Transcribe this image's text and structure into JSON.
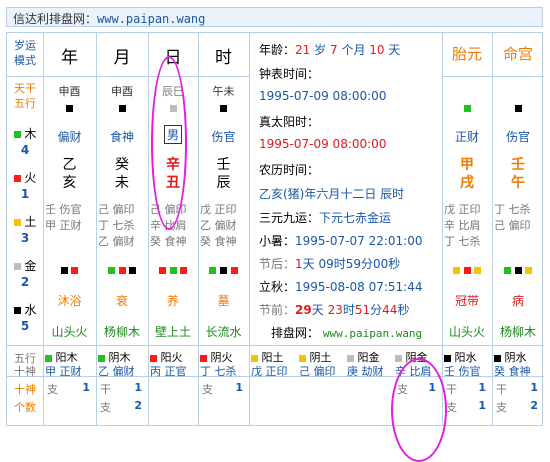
{
  "topbar": {
    "site": "信达利排盘网：",
    "url": "www.paipan.wang"
  },
  "left": {
    "row1": [
      "岁运",
      "模式"
    ],
    "row2": [
      "天干",
      "五行"
    ],
    "elements": [
      {
        "name": "木",
        "count": "4"
      },
      {
        "name": "火",
        "count": "1"
      },
      {
        "name": "土",
        "count": "3"
      },
      {
        "name": "金",
        "count": "2"
      },
      {
        "name": "水",
        "count": "5"
      }
    ],
    "bottom1": [
      "五行",
      "十神"
    ],
    "bottom2": [
      "十神",
      "个数"
    ]
  },
  "pillars": {
    "headers": [
      "年",
      "月",
      "日",
      "时"
    ],
    "hidden": [
      "申酉",
      "申酉",
      "辰巳",
      "午未"
    ],
    "shishen_top": [
      "偏财",
      "食神",
      "男",
      "伤官"
    ],
    "gan": [
      "乙",
      "癸",
      "辛",
      "壬"
    ],
    "zhi": [
      "亥",
      "未",
      "丑",
      "辰"
    ],
    "canggan": [
      [
        "壬 伤官",
        "甲 正财"
      ],
      [
        "己 偏印",
        "丁 七杀",
        "乙 偏财"
      ],
      [
        "己 偏印",
        "辛 比肩",
        "癸 食神"
      ],
      [
        "戊 正印",
        "乙 偏财",
        "癸 食神"
      ]
    ],
    "state": [
      "沐浴",
      "衰",
      "养",
      "墓"
    ],
    "nayin": [
      "山头火",
      "杨柳木",
      "壁上土",
      "长流水"
    ]
  },
  "info": {
    "age": {
      "label": "年龄：",
      "y": "21",
      "yl": "岁",
      "m": "7",
      "ml": "个月",
      "d": "10",
      "dl": "天"
    },
    "clock_label": "钟表时间：",
    "clock_value": "1995-07-09 08:00:00",
    "solar_label": "真太阳时：",
    "solar_value": "1995-07-09 08:00:00",
    "lunar_label": "农历时间：",
    "lunar_value": "乙亥(猪)年六月十二日 辰时",
    "yuan_label": "三元九运：",
    "yuan_value": "下元七赤金运",
    "xs_label": "小暑：",
    "xs_value": "1995-07-07 22:01:00",
    "jh_label": "节后：",
    "jh_d": "1",
    "jh_rest": "天 09时59分00秒",
    "lq_label": "立秋：",
    "lq_value": "1995-08-08 07:51:44",
    "jq_label": "节前：",
    "jq_d": "29",
    "jq_t1": "天",
    "jq_h": "23",
    "jq_t2": "时",
    "jq_m": "51",
    "jq_t3": "分",
    "jq_s": "44",
    "jq_t4": "秒",
    "site_label": "排盘网：",
    "site_url": "www.paipan.wang"
  },
  "right": {
    "headers": [
      "胎元",
      "命宫"
    ],
    "shishen": [
      "正财",
      "伤官"
    ],
    "gan": [
      "甲",
      "壬"
    ],
    "zhi": [
      "戌",
      "午"
    ],
    "canggan": [
      [
        "戊 正印",
        "辛 比肩",
        "丁 七杀"
      ],
      [
        "丁 七杀",
        "己 偏印"
      ]
    ],
    "state": [
      "冠带",
      "病"
    ],
    "nayin": [
      "山头火",
      "杨柳木"
    ]
  },
  "bottom": {
    "cells": [
      {
        "top": "阳木",
        "bot": "甲 正财"
      },
      {
        "top": "阴木",
        "bot": "乙 偏财"
      },
      {
        "top": "阳火",
        "bot": "丙 正官"
      },
      {
        "top": "阴火",
        "bot": "丁 七杀"
      },
      {
        "top": "阳土",
        "bot": "戊 正印"
      },
      {
        "top": "阴土",
        "bot": "己 偏印"
      },
      {
        "top": "阳金",
        "bot": "庚 劫财"
      },
      {
        "top": "阴金",
        "bot": "辛 比肩"
      },
      {
        "top": "阳水",
        "bot": "壬 伤官"
      },
      {
        "top": "阴水",
        "bot": "癸 食神"
      }
    ],
    "counts": [
      {
        "a": "支",
        "an": "1"
      },
      {
        "a": "干",
        "an": "1",
        "b": "支",
        "bn": "2"
      },
      {
        "a": "支",
        "an": "1"
      },
      {
        "a": "支",
        "an": "1"
      },
      {
        "a": "干",
        "an": "1",
        "b": "支",
        "bn": "1"
      },
      {
        "a": "干",
        "an": "1",
        "b": "支",
        "bn": "2"
      }
    ]
  },
  "colors": {
    "accent": "#1a57a6",
    "red": "#e21b1b",
    "orange": "#ee7d00",
    "green": "#1b8a1b",
    "grid": "#b9cfe6",
    "highlight": "#e41ce3"
  }
}
